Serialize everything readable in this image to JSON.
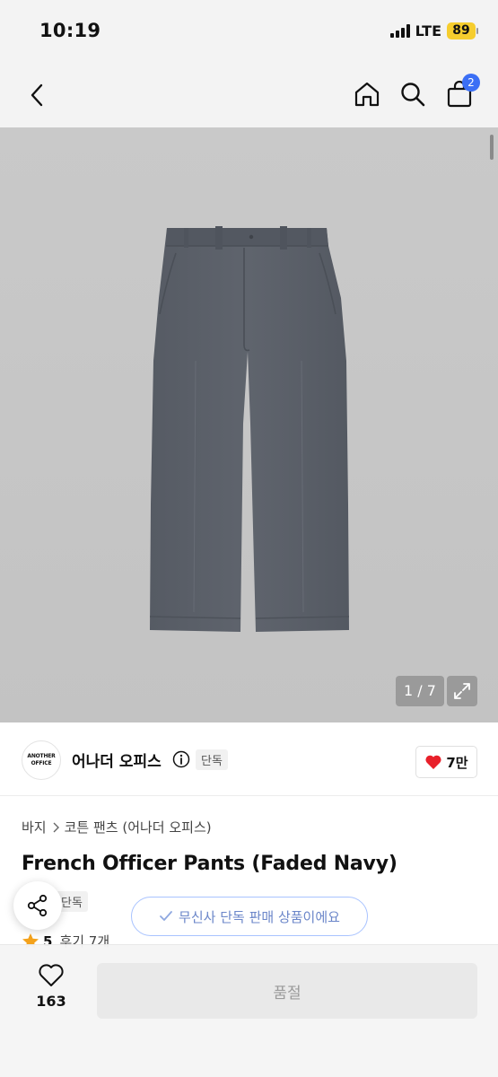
{
  "status_bar": {
    "time": "10:19",
    "network": "LTE",
    "battery": "89"
  },
  "header": {
    "cart_count": "2"
  },
  "gallery": {
    "counter": "1 / 7"
  },
  "brand": {
    "logo_line1": "ANOTHER",
    "logo_line2": "OFFICE",
    "name": "어나더 오피스",
    "badge": "단독",
    "like_count": "7만"
  },
  "breadcrumb": {
    "level1": "바지",
    "level2": "코튼 팬츠 (어나더 오피스)"
  },
  "product": {
    "title": "French Officer Pants (Faded Navy)",
    "badge": "단독",
    "exclusive_notice": "무신사 단독 판매 상품이에요",
    "rating": "5",
    "reviews": "후기 7개"
  },
  "bottom_bar": {
    "wish_count": "163",
    "buy_label": "품절"
  },
  "colors": {
    "accent_blue": "#3b6ff5",
    "heart_red": "#e8202a",
    "pants": "#5b6069"
  }
}
